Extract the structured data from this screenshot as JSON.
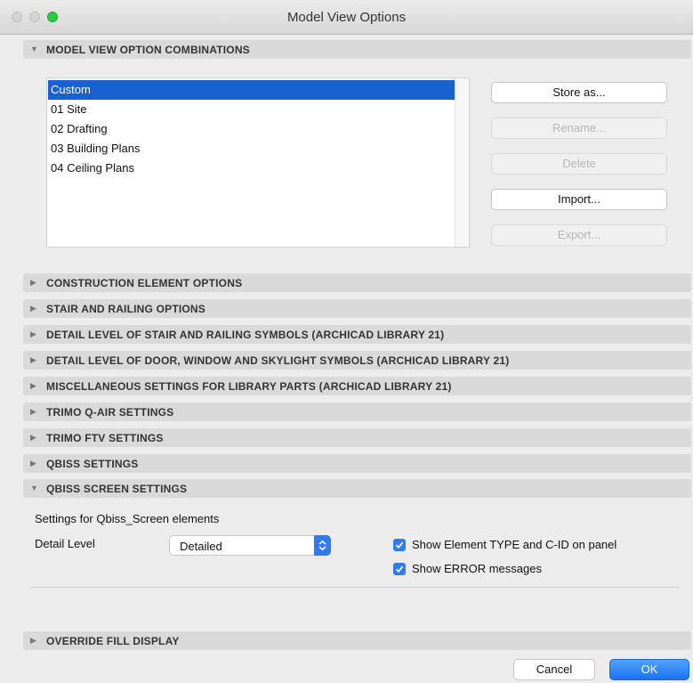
{
  "window": {
    "title": "Model View Options"
  },
  "combinations": {
    "header": "MODEL VIEW OPTION COMBINATIONS",
    "items": [
      "Custom",
      "01 Site",
      "02 Drafting",
      "03 Building Plans",
      "04 Ceiling Plans"
    ],
    "selected": "Custom",
    "buttons": {
      "store_as": "Store as...",
      "rename": "Rename...",
      "delete": "Delete",
      "import": "Import...",
      "export": "Export..."
    }
  },
  "sections": [
    "CONSTRUCTION ELEMENT OPTIONS",
    "STAIR AND RAILING OPTIONS",
    "DETAIL LEVEL OF STAIR AND RAILING SYMBOLS (ARCHICAD LIBRARY 21)",
    "DETAIL LEVEL OF DOOR, WINDOW AND SKYLIGHT SYMBOLS (ARCHICAD LIBRARY 21)",
    "MISCELLANEOUS SETTINGS FOR LIBRARY PARTS (ARCHICAD LIBRARY 21)",
    "TRIMO Q-AIR SETTINGS",
    "TRIMO FTV SETTINGS",
    "QBISS SETTINGS"
  ],
  "qbiss_screen": {
    "header": "QBISS SCREEN SETTINGS",
    "description": "Settings for Qbiss_Screen elements",
    "detail_level_label": "Detail Level",
    "detail_level_value": "Detailed",
    "show_type_label": "Show Element TYPE and C-ID on panel",
    "show_type_checked": true,
    "show_errors_label": "Show ERROR messages",
    "show_errors_checked": true
  },
  "override_fill": {
    "header": "OVERRIDE FILL DISPLAY"
  },
  "footer": {
    "cancel": "Cancel",
    "ok": "OK"
  },
  "colors": {
    "accent": "#2f7bf5",
    "selection": "#1761d3"
  },
  "icons": {
    "expanded": "triangle-down-icon",
    "collapsed": "triangle-right-icon",
    "stepper": "chevron-updown-icon",
    "checkbox": "checkmark-icon"
  }
}
